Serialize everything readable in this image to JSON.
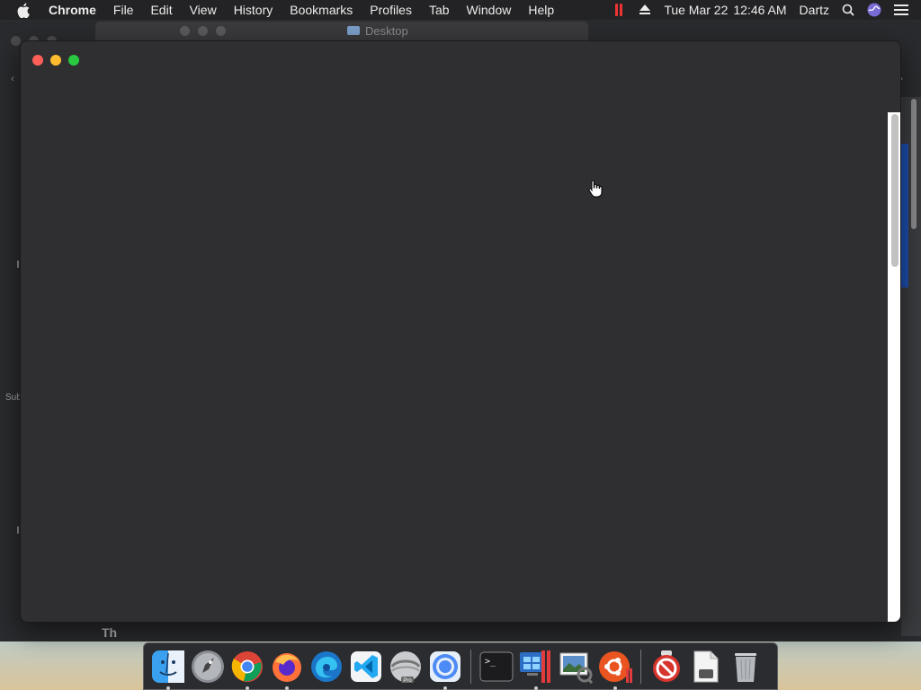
{
  "menubar": {
    "app_name": "Chrome",
    "items": [
      "File",
      "Edit",
      "View",
      "History",
      "Bookmarks",
      "Profiles",
      "Tab",
      "Window",
      "Help"
    ],
    "date": "Tue Mar 22",
    "time": "12:46 AM",
    "user": "Dartz"
  },
  "background": {
    "window_title": "Desktop",
    "side_text": "Sub",
    "bottom_text": "Th"
  },
  "dock": {
    "apps": [
      {
        "name": "Finder",
        "icon": "finder-icon",
        "running": true
      },
      {
        "name": "Launchpad",
        "icon": "launchpad-icon",
        "running": false
      },
      {
        "name": "Google Chrome",
        "icon": "chrome-icon",
        "running": true
      },
      {
        "name": "Firefox",
        "icon": "firefox-icon",
        "running": true
      },
      {
        "name": "Microsoft Edge",
        "icon": "edge-icon",
        "running": false
      },
      {
        "name": "Visual Studio Code",
        "icon": "vscode-icon",
        "running": false
      },
      {
        "name": "Parallels Desktop Pro",
        "icon": "parallels-pro-icon",
        "running": false,
        "badge": "Pro"
      },
      {
        "name": "Chromium",
        "icon": "chromium-icon",
        "running": true
      }
    ],
    "apps_right": [
      {
        "name": "Terminal",
        "icon": "terminal-icon",
        "running": false
      },
      {
        "name": "Parallels Windows VM",
        "icon": "windows-vm-icon",
        "running": true
      },
      {
        "name": "Preview",
        "icon": "preview-icon",
        "running": false
      },
      {
        "name": "Ubuntu VM",
        "icon": "ubuntu-icon",
        "running": true
      }
    ],
    "apps_trash_section": [
      {
        "name": "No Entry App",
        "icon": "no-entry-icon",
        "running": false
      },
      {
        "name": "Document",
        "icon": "document-icon",
        "running": false
      },
      {
        "name": "Trash",
        "icon": "trash-icon",
        "running": false
      }
    ]
  },
  "colors": {
    "window_bg": "#2f2f31",
    "close": "#fe5f57",
    "minimize": "#febc2e",
    "maximize": "#28c840"
  }
}
